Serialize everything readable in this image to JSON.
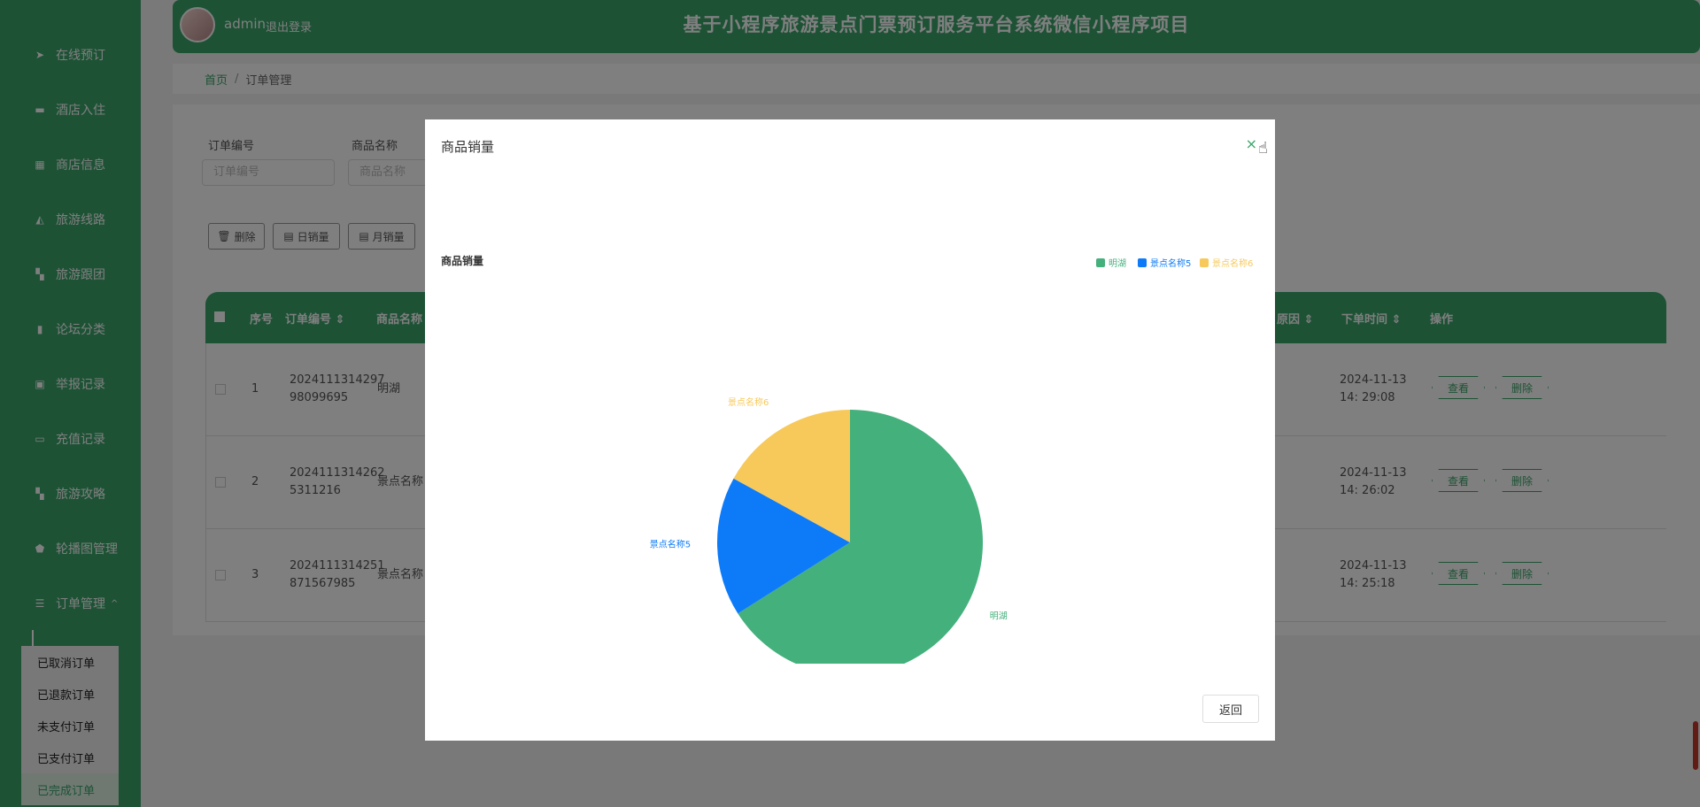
{
  "sidebar": {
    "items": [
      {
        "label": "在线预订",
        "icon": "send-icon"
      },
      {
        "label": "酒店入住",
        "icon": "briefcase-icon"
      },
      {
        "label": "商店信息",
        "icon": "store-icon"
      },
      {
        "label": "旅游线路",
        "icon": "route-icon"
      },
      {
        "label": "旅游跟团",
        "icon": "grid-icon"
      },
      {
        "label": "论坛分类",
        "icon": "bar-chart-icon"
      },
      {
        "label": "举报记录",
        "icon": "clipboard-icon"
      },
      {
        "label": "充值记录",
        "icon": "card-icon"
      },
      {
        "label": "旅游攻略",
        "icon": "grid-icon"
      },
      {
        "label": "轮播图管理",
        "icon": "shield-icon"
      },
      {
        "label": "订单管理",
        "icon": "menu-icon"
      }
    ],
    "submenu": [
      {
        "label": "已取消订单"
      },
      {
        "label": "已退款订单"
      },
      {
        "label": "未支付订单"
      },
      {
        "label": "已支付订单"
      },
      {
        "label": "已完成订单"
      }
    ]
  },
  "header": {
    "username": "admin",
    "logout": "退出登录",
    "title": "基于小程序旅游景点门票预订服务平台系统微信小程序项目"
  },
  "breadcrumb": {
    "home": "首页",
    "separator": "/",
    "current": "订单管理"
  },
  "filters": {
    "order_no_label": "订单编号",
    "order_no_placeholder": "订单编号",
    "product_label": "商品名称",
    "product_placeholder": "商品名称"
  },
  "toolbar": {
    "delete": "删除",
    "daily": "日销量",
    "monthly": "月销量"
  },
  "table": {
    "headers": {
      "index": "序号",
      "order_no": "订单编号 ⇕",
      "product": "商品名称",
      "reason": "原因 ⇕",
      "time": "下单时间 ⇕",
      "actions": "操作"
    },
    "rows": [
      {
        "index": "1",
        "order_no": "2024111314297 98099695",
        "product": "明湖",
        "time": "2024-11-13 14: 29:08"
      },
      {
        "index": "2",
        "order_no": "2024111314262 5311216",
        "product": "景点名称",
        "time": "2024-11-13 14: 26:02"
      },
      {
        "index": "3",
        "order_no": "2024111314251 871567985",
        "product": "景点名称",
        "time": "2024-11-13 14: 25:18"
      }
    ],
    "view": "查看",
    "delete": "删除"
  },
  "modal": {
    "title": "商品销量",
    "close": "×",
    "back": "返回"
  },
  "chart_data": {
    "type": "pie",
    "title": "商品销量",
    "legend_position": "top-right",
    "categories": [
      "明湖",
      "景点名称5",
      "景点名称6"
    ],
    "values": [
      66,
      17,
      17
    ],
    "colors": [
      "#44b07c",
      "#0d7bf8",
      "#f7c95b"
    ]
  }
}
